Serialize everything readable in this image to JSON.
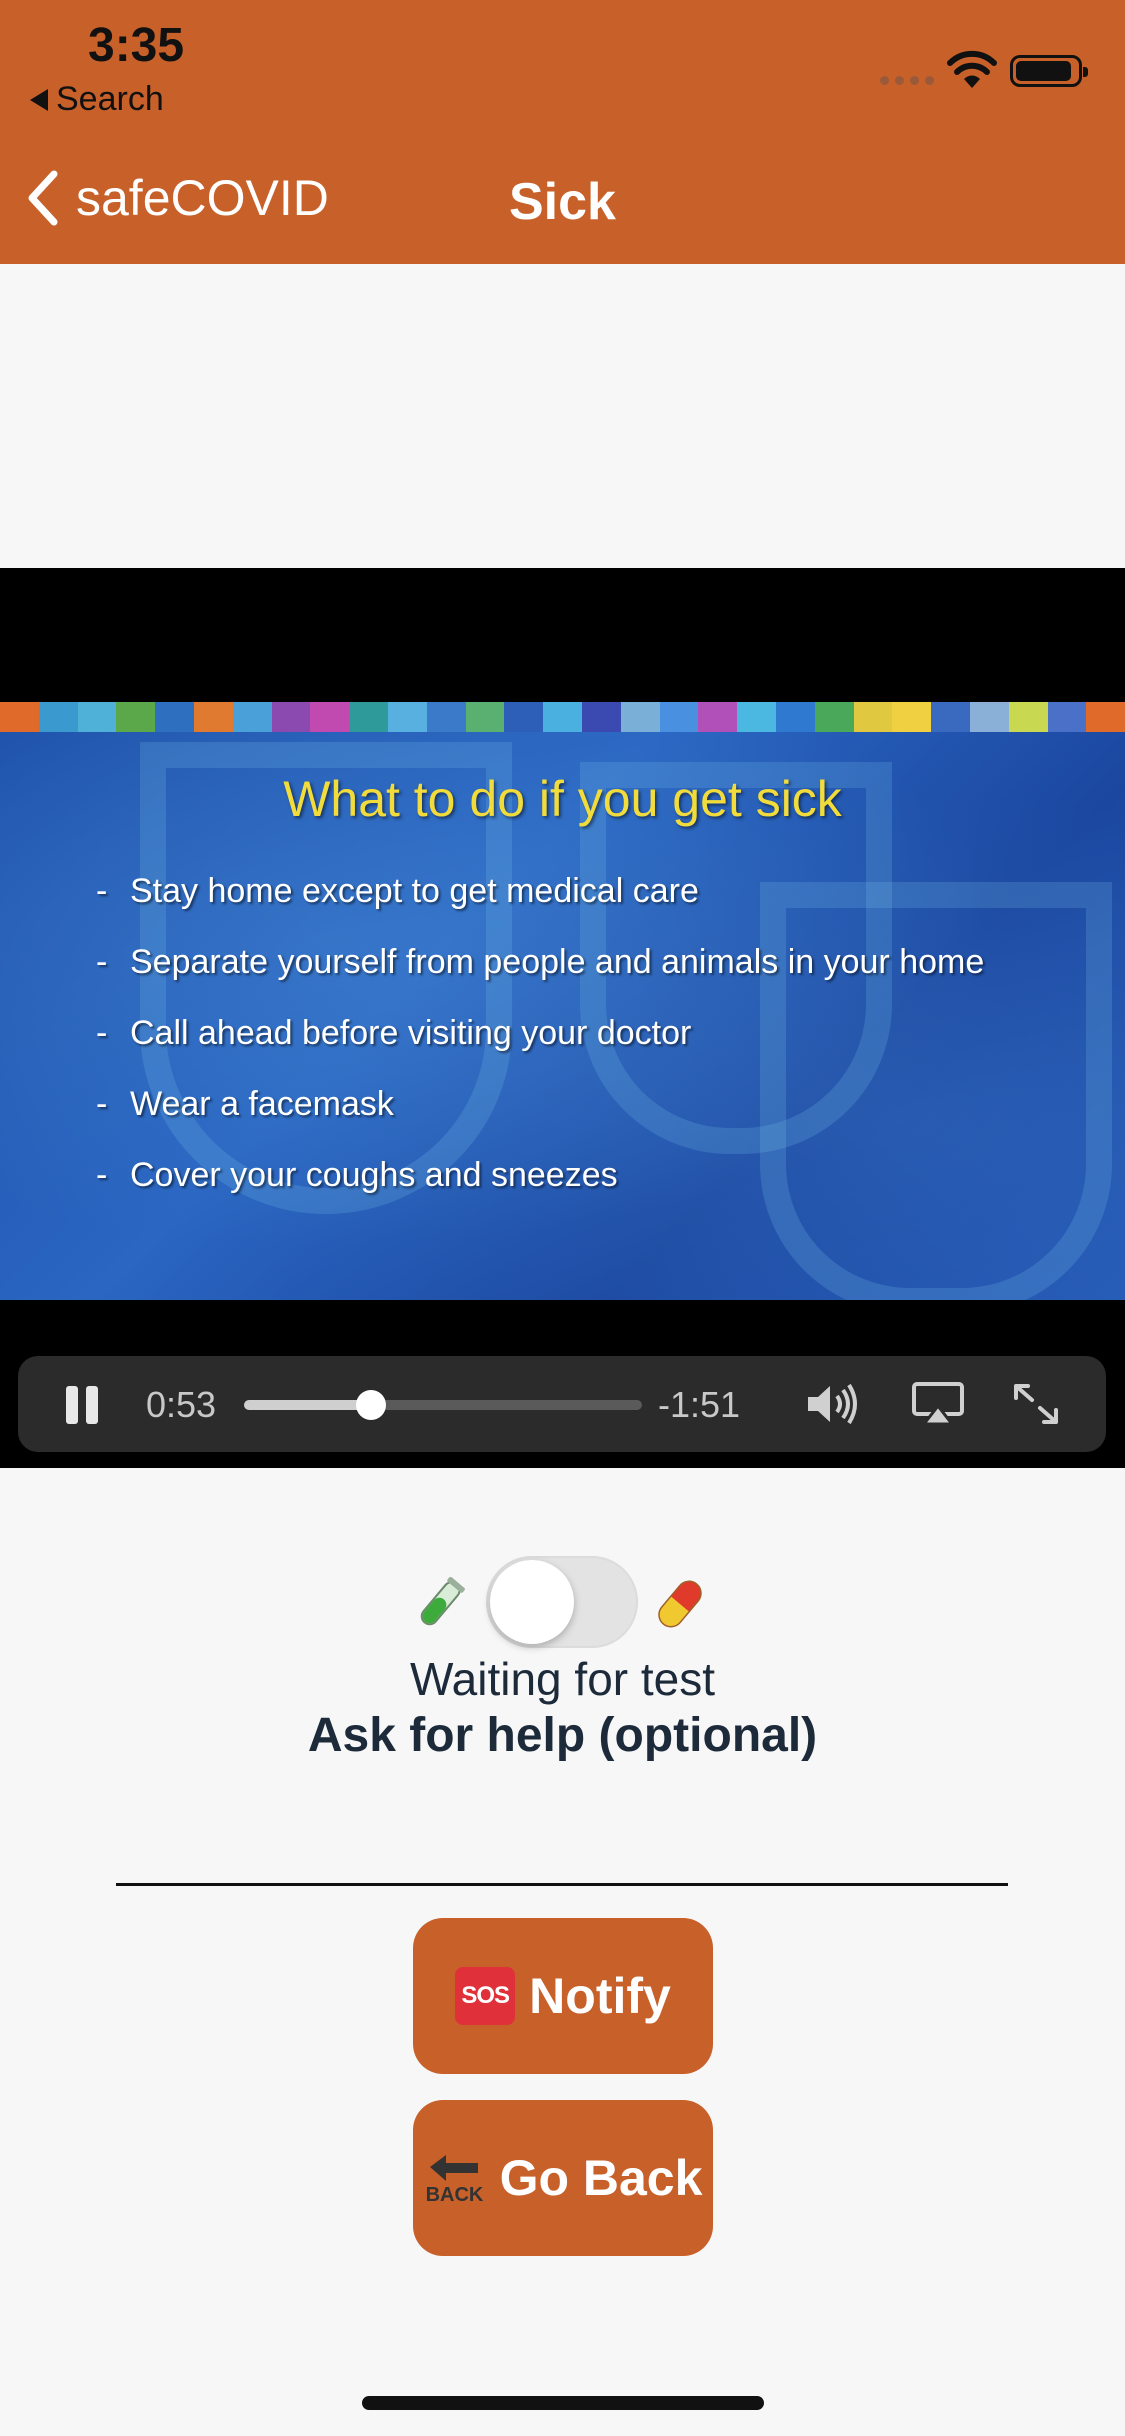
{
  "status_bar": {
    "time": "3:35",
    "back_app": "Search"
  },
  "nav": {
    "back_label": "safeCOVID",
    "title": "Sick"
  },
  "slide": {
    "title": "What to do if you get sick",
    "bullets": [
      "Stay home except to get medical care",
      "Separate yourself from people and animals in your home",
      "Call ahead before visiting your doctor",
      "Wear a facemask",
      "Cover your coughs and sneezes"
    ],
    "strip_colors": [
      "#e06a2a",
      "#3a9ad0",
      "#4fb0d8",
      "#5aa84a",
      "#2f6fc0",
      "#e07a30",
      "#4aa0d8",
      "#8a4ab0",
      "#c04ab0",
      "#2f9a9a",
      "#58b0e0",
      "#3a7ac8",
      "#5ab070",
      "#2e5fb8",
      "#4ab0e0",
      "#3a4ab0",
      "#7ab0d8",
      "#4a90e0",
      "#b050b8",
      "#4ab8e0",
      "#2f7ad0",
      "#4aa85a",
      "#e0c840",
      "#f0d040",
      "#3a6ac0",
      "#8ab0d8",
      "#c8d850",
      "#4a70c8",
      "#e06a2a"
    ]
  },
  "player": {
    "elapsed": "0:53",
    "remaining": "-1:51",
    "progress": 0.32
  },
  "toggle": {
    "on": false,
    "status": "Waiting for test"
  },
  "help": {
    "heading": "Ask for help (optional)",
    "input_value": "",
    "input_placeholder": ""
  },
  "buttons": {
    "notify_label": "Notify",
    "sos_badge": "SOS",
    "go_back_label": "Go Back",
    "back_badge": "BACK"
  },
  "colors": {
    "accent": "#c8602a"
  }
}
